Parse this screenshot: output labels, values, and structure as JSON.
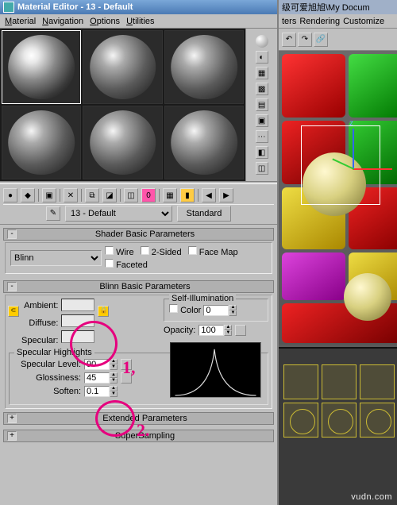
{
  "title": "Material Editor - 13 - Default",
  "menubar": [
    "Material",
    "Navigation",
    "Options",
    "Utilities"
  ],
  "right_title": "级可爱旭旭\\My Docum",
  "right_menu": [
    "ters",
    "Rendering",
    "Customize"
  ],
  "toolbar2": {
    "material_name": "13 - Default",
    "standard_btn": "Standard"
  },
  "rollouts": {
    "shader": "Shader Basic Parameters",
    "blinn": "Blinn Basic Parameters",
    "extended": "Extended Parameters",
    "supersampling": "SuperSampling"
  },
  "shader_panel": {
    "type": "Blinn",
    "wire": "Wire",
    "two_sided": "2-Sided",
    "face_map": "Face Map",
    "faceted": "Faceted"
  },
  "blinn_panel": {
    "ambient": "Ambient:",
    "diffuse": "Diffuse:",
    "specular": "Specular:",
    "self_illum": "Self-Illumination",
    "color_label": "Color",
    "color_val": "0",
    "opacity": "Opacity:",
    "opacity_val": "100",
    "spec_group": "Specular Highlights",
    "spec_level": "Specular Level:",
    "spec_level_val": "90",
    "gloss": "Glossiness:",
    "gloss_val": "45",
    "soften": "Soften:",
    "soften_val": "0.1"
  },
  "annotations": {
    "one": "1,",
    "two": "2."
  },
  "watermark": "vudn.com"
}
